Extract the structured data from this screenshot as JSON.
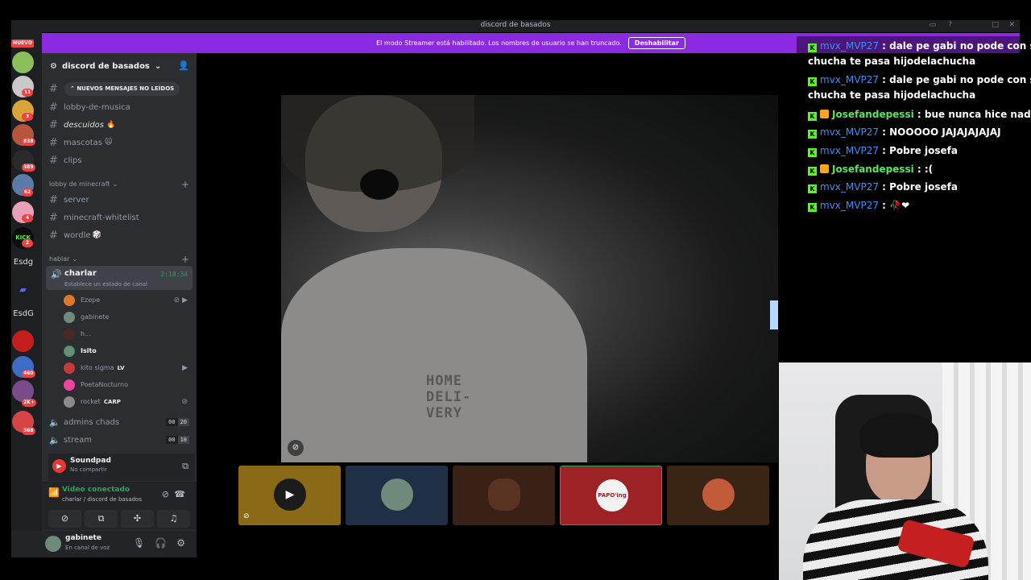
{
  "window": {
    "title": "discord de basados"
  },
  "banner": {
    "text": "El modo Streamer está habilitado. Los nombres de usuario se han truncado.",
    "button": "Deshabilitar"
  },
  "rail": {
    "new_label": "NUEVO",
    "badges": [
      "11",
      "3",
      "838",
      "389",
      "62",
      "4",
      "2",
      "460",
      "2K+",
      "368"
    ],
    "esdg1": "Esdg",
    "esdg2": "EsdG"
  },
  "guild": {
    "name": "discord de basados"
  },
  "new_messages": "NUEVOS MENSAJES NO LEÍDOS",
  "channels_top": [
    {
      "name": "lobby-de-musica"
    },
    {
      "name": "descuidos"
    },
    {
      "name": "mascotas"
    },
    {
      "name": "clips"
    }
  ],
  "categories": {
    "minecraft": "lobby de minecraft",
    "hablar": "hablar"
  },
  "channels_minecraft": [
    {
      "name": "server"
    },
    {
      "name": "minecraft-whitelist"
    },
    {
      "name": "wordle"
    }
  ],
  "voice_active": {
    "name": "charlar",
    "timer": "2:18:34",
    "status": "Establece un estado de canal"
  },
  "voice_users": [
    {
      "name": "Ezepe",
      "tag": ""
    },
    {
      "name": "gabinete",
      "tag": ""
    },
    {
      "name": "h...",
      "tag": ""
    },
    {
      "name": "Isito",
      "tag": ""
    },
    {
      "name": "kito sigma",
      "tag": "LV"
    },
    {
      "name": "PoetaNocturno",
      "tag": ""
    },
    {
      "name": "rocket",
      "tag": "CARP"
    }
  ],
  "voice_channels": [
    {
      "name": "admins chads",
      "count_a": "00",
      "count_b": "20"
    },
    {
      "name": "stream",
      "count_a": "00",
      "count_b": "10"
    }
  ],
  "soundpad": {
    "title": "Soundpad",
    "subtitle": "No compartir"
  },
  "rtc": {
    "status": "Video conectado",
    "location": "charlar / discord de basados"
  },
  "user_panel": {
    "name": "gabinete",
    "status": "En canal de voz"
  },
  "video": {
    "shirt_print": "HOME\nDELI-\nVERY"
  },
  "tiles": [
    {
      "kind": "camera-off",
      "color": "#8a6a16"
    },
    {
      "kind": "avatar",
      "color": "#1f2f45"
    },
    {
      "kind": "video",
      "color": "#3a2118"
    },
    {
      "kind": "avatar",
      "color": "#9c2226",
      "label": "PAPO'ing"
    },
    {
      "kind": "avatar",
      "color": "#3a2414"
    }
  ],
  "chat": [
    {
      "user": "mvx_MVP27",
      "text": " : dale pe gabi no pode con strin",
      "wrap": "chucha te pasa hijodelachucha",
      "style": "u1"
    },
    {
      "user": "mvx_MVP27",
      "text": " : dale pe gabi no pode con strin",
      "wrap": "chucha te pasa hijodelachucha",
      "style": "u1"
    },
    {
      "user": "Josefandepessi",
      "text": " : bue nunca hice nada",
      "style": "u2"
    },
    {
      "user": "mvx_MVP27",
      "text": " : NOOOOO JAJAJAJAJAJ",
      "style": "u1"
    },
    {
      "user": "mvx_MVP27",
      "text": " : Pobre josefa",
      "style": "u1"
    },
    {
      "user": "Josefandepessi",
      "text": " : :(",
      "style": "u2"
    },
    {
      "user": "mvx_MVP27",
      "text": " : Pobre josefa",
      "style": "u1"
    },
    {
      "user": "mvx_MVP27",
      "text": " : 🥀❤",
      "style": "u1"
    }
  ]
}
